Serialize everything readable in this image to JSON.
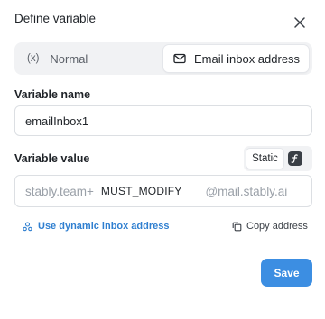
{
  "dialog": {
    "title": "Define variable",
    "close_icon": "close-icon"
  },
  "mode_switch": {
    "normal_icon_text": "(x)",
    "normal_label": "Normal",
    "email_label": "Email inbox address",
    "email_icon": "envelope-icon",
    "selected": "Email inbox address"
  },
  "variable_name": {
    "label": "Variable name",
    "value": "emailInbox1"
  },
  "variable_value": {
    "label": "Variable value",
    "toggle_static_label": "Static",
    "toggle_dynamic_icon": "function-icon",
    "prefix": "stably.team+",
    "middle": "MUST_MODIFY",
    "suffix": "@mail.stably.ai"
  },
  "links": {
    "dynamic_label": "Use dynamic inbox address",
    "dynamic_icon": "users-icon",
    "copy_label": "Copy address",
    "copy_icon": "copy-icon"
  },
  "footer": {
    "save_label": "Save"
  },
  "colors": {
    "accent": "#3c8ee2",
    "link": "#2f7fd0"
  }
}
